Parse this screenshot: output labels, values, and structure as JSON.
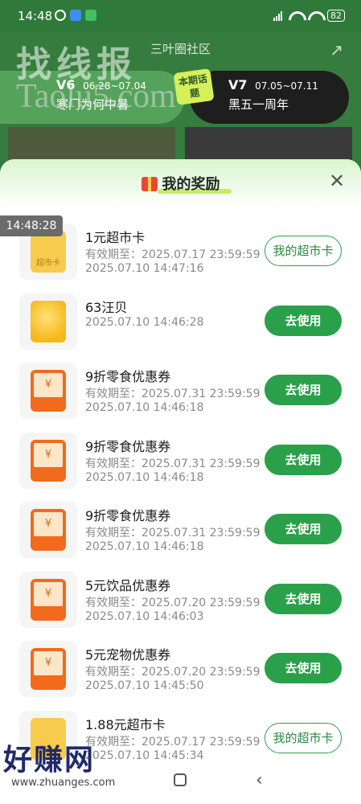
{
  "status": {
    "time": "14:48",
    "battery": "82"
  },
  "header": {
    "title": "三叶圈社区"
  },
  "watermark": {
    "cn": "找线报",
    "en": "Taolu5.com"
  },
  "promo": {
    "left_version": "V6",
    "left_dates": "06.28~07.04",
    "left_sub": "寒门为何中暑",
    "badge": "本期话题",
    "right_version": "V7",
    "right_dates": "07.05~07.11",
    "right_sub": "黑五一周年"
  },
  "sheet": {
    "title": "我的奖励"
  },
  "overlay_time": "14:48:28",
  "items": [
    {
      "icon": "supermarket-card-icon",
      "name": "1元超市卡",
      "line1": "有效期至：2025.07.17 23:59:59",
      "line2": "2025.07.10 14:47:16",
      "button": "我的超市卡",
      "style": "outline"
    },
    {
      "icon": "coin-icon",
      "name": "63汪贝",
      "line1": "2025.07.10 14:46:28",
      "line2": "",
      "button": "去使用",
      "style": "use"
    },
    {
      "icon": "coupon-icon",
      "name": "9折零食优惠券",
      "line1": "有效期至：2025.07.31 23:59:59",
      "line2": "2025.07.10 14:46:18",
      "button": "去使用",
      "style": "use"
    },
    {
      "icon": "coupon-icon",
      "name": "9折零食优惠券",
      "line1": "有效期至：2025.07.31 23:59:59",
      "line2": "2025.07.10 14:46:18",
      "button": "去使用",
      "style": "use"
    },
    {
      "icon": "coupon-icon",
      "name": "9折零食优惠券",
      "line1": "有效期至：2025.07.31 23:59:59",
      "line2": "2025.07.10 14:46:18",
      "button": "去使用",
      "style": "use"
    },
    {
      "icon": "coupon-icon",
      "name": "5元饮品优惠券",
      "line1": "有效期至：2025.07.20 23:59:59",
      "line2": "2025.07.10 14:46:03",
      "button": "去使用",
      "style": "use"
    },
    {
      "icon": "coupon-icon",
      "name": "5元宠物优惠券",
      "line1": "有效期至：2025.07.20 23:59:59",
      "line2": "2025.07.10 14:45:50",
      "button": "去使用",
      "style": "use"
    },
    {
      "icon": "supermarket-card-icon",
      "name": "1.88元超市卡",
      "line1": "有效期至：2025.07.17 23:59:59",
      "line2": "2025.07.10 14:45:34",
      "button": "我的超市卡",
      "style": "outline"
    }
  ],
  "bottom_watermark": {
    "cn": "好赚网",
    "url": "www.zhuanges.com"
  }
}
